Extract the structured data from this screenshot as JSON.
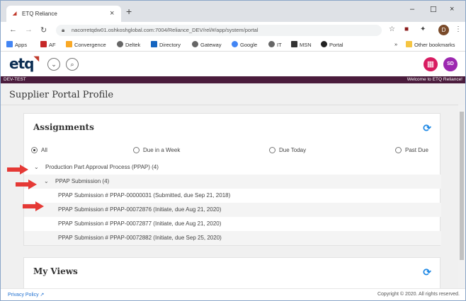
{
  "browser": {
    "tab_title": "ETQ Reliance",
    "tab_close": "×",
    "new_tab": "+",
    "url": "nacorretqdw01.oshkoshglobal.com:7004/Reliance_DEV/rel/#/app/system/portal",
    "profile_initial": "D",
    "window_controls": {
      "minimize": "–",
      "maximize": "☐",
      "close": "×"
    },
    "bookmarks": [
      "Apps",
      "AF",
      "Convergence",
      "Deltek",
      "Directory",
      "Gateway",
      "Google",
      "IT",
      "MSN",
      "Portal"
    ],
    "bookmarks_overflow": "»",
    "other_bookmarks": "Other bookmarks"
  },
  "app": {
    "logo": "etq",
    "env_label": "DEV-TEST",
    "welcome": "Welcome to ETQ Reliance!",
    "avatar_initials": "SD"
  },
  "page": {
    "title": "Supplier Portal Profile",
    "assignments": {
      "title": "Assignments",
      "filters": [
        {
          "label": "All",
          "selected": true
        },
        {
          "label": "Due in a Week",
          "selected": false
        },
        {
          "label": "Due Today",
          "selected": false
        },
        {
          "label": "Past Due",
          "selected": false
        }
      ],
      "group_label": "Production Part Approval Process (PPAP) (4)",
      "subgroup_label": "PPAP Submission (4)",
      "items": [
        "PPAP Submission # PPAP-00000031 (Submitted, due Sep 21, 2018)",
        "PPAP Submission # PPAP-00072876 (Initiate, due Aug 21, 2020)",
        "PPAP Submission # PPAP-00072877 (Initiate, due Aug 21, 2020)",
        "PPAP Submission # PPAP-00072882 (Initiate, due Sep 25, 2020)"
      ]
    },
    "my_views": {
      "title": "My Views"
    }
  },
  "footer": {
    "privacy": "Privacy Policy",
    "copyright": "Copyright © 2020. All rights reserved."
  },
  "colors": {
    "accent_blue": "#1e88e5",
    "env_bar": "#4a1c3c",
    "annotation_arrow": "#e53935",
    "avatar": "#9c27b0",
    "apps_button": "#d81b60"
  }
}
